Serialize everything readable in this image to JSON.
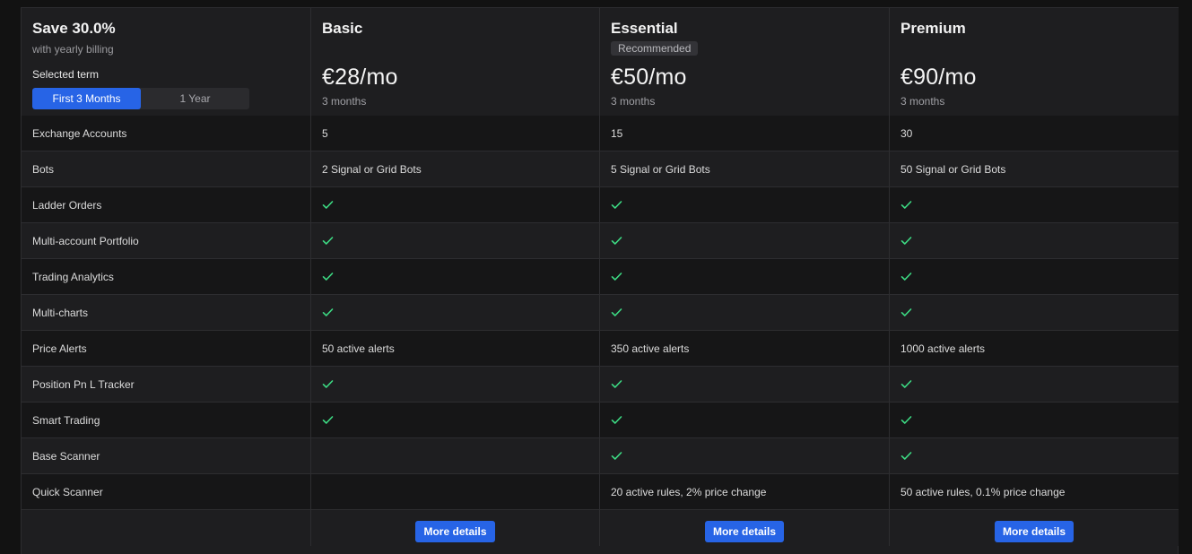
{
  "header": {
    "save_title": "Save 30.0%",
    "save_subtitle": "with yearly billing",
    "term_label": "Selected term",
    "term_options": [
      "First 3 Months",
      "1 Year"
    ],
    "selected_term": "First 3 Months"
  },
  "plans": [
    {
      "name": "Basic",
      "badge": "",
      "price": "€28/mo",
      "term": "3 months",
      "button": "More details"
    },
    {
      "name": "Essential",
      "badge": "Recommended",
      "price": "€50/mo",
      "term": "3 months",
      "button": "More details"
    },
    {
      "name": "Premium",
      "badge": "",
      "price": "€90/mo",
      "term": "3 months",
      "button": "More details"
    }
  ],
  "features": [
    {
      "label": "Exchange Accounts",
      "values": [
        "5",
        "15",
        "30"
      ]
    },
    {
      "label": "Bots",
      "values": [
        "2 Signal or Grid Bots",
        "5 Signal or Grid Bots",
        "50 Signal or Grid Bots"
      ]
    },
    {
      "label": "Ladder Orders",
      "values": [
        "check",
        "check",
        "check"
      ]
    },
    {
      "label": "Multi-account Portfolio",
      "values": [
        "check",
        "check",
        "check"
      ]
    },
    {
      "label": "Trading Analytics",
      "values": [
        "check",
        "check",
        "check"
      ]
    },
    {
      "label": "Multi-charts",
      "values": [
        "check",
        "check",
        "check"
      ]
    },
    {
      "label": "Price Alerts",
      "values": [
        "50 active alerts",
        "350 active alerts",
        "1000 active alerts"
      ]
    },
    {
      "label": "Position Pn L Tracker",
      "values": [
        "check",
        "check",
        "check"
      ]
    },
    {
      "label": "Smart Trading",
      "values": [
        "check",
        "check",
        "check"
      ]
    },
    {
      "label": "Base Scanner",
      "values": [
        "",
        "check",
        "check"
      ]
    },
    {
      "label": "Quick Scanner",
      "values": [
        "",
        "20 active rules, 2% price change",
        "50 active rules, 0.1% price change"
      ]
    }
  ],
  "colors": {
    "accent": "#2764e6",
    "check": "#3ddc84",
    "background": "#1e1e20"
  },
  "icons": {
    "check": "check-icon"
  }
}
